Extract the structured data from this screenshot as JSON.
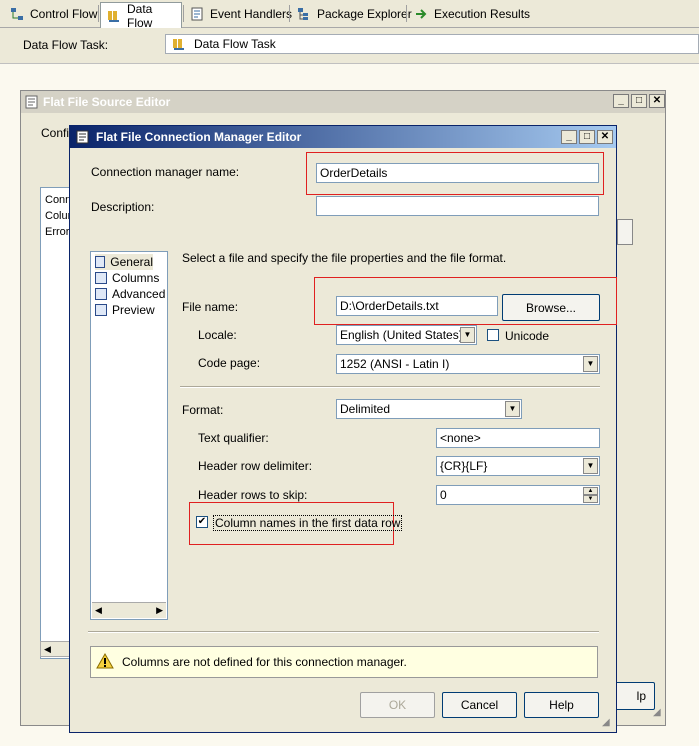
{
  "tabs": [
    {
      "label": "Control Flow",
      "icon": "control-flow-icon"
    },
    {
      "label": "Data Flow",
      "icon": "data-flow-icon"
    },
    {
      "label": "Event Handlers",
      "icon": "event-handlers-icon"
    },
    {
      "label": "Package Explorer",
      "icon": "package-explorer-icon"
    },
    {
      "label": "Execution Results",
      "icon": "execution-results-icon"
    }
  ],
  "task": {
    "label": "Data Flow Task:",
    "value": "Data Flow Task"
  },
  "back_dialog": {
    "title": "Flat File Source Editor",
    "conf_label": "Confi",
    "list_items": [
      "Conn",
      "Colur",
      "Error"
    ],
    "help_partial": "lp"
  },
  "dialog": {
    "title": "Flat File Connection Manager Editor",
    "conn_name_label": "Connection manager name:",
    "conn_name_value": "OrderDetails",
    "description_label": "Description:",
    "description_value": "",
    "nav": [
      {
        "label": "General",
        "icon": "general-icon"
      },
      {
        "label": "Columns",
        "icon": "columns-icon"
      },
      {
        "label": "Advanced",
        "icon": "advanced-icon"
      },
      {
        "label": "Preview",
        "icon": "preview-icon"
      }
    ],
    "intro": "Select a file and specify the file properties and the file format.",
    "file_name_label": "File name:",
    "file_name_value": "D:\\OrderDetails.txt",
    "browse_label": "Browse...",
    "locale_label": "Locale:",
    "locale_value": "English (United States)",
    "unicode_label": "Unicode",
    "unicode_checked": false,
    "code_page_label": "Code page:",
    "code_page_value": "1252  (ANSI - Latin I)",
    "format_label": "Format:",
    "format_value": "Delimited",
    "text_qualifier_label": "Text qualifier:",
    "text_qualifier_value": "<none>",
    "header_row_delim_label": "Header row delimiter:",
    "header_row_delim_value": "{CR}{LF}",
    "header_rows_skip_label": "Header rows to skip:",
    "header_rows_skip_value": "0",
    "column_names_label": "Column names in the first data row",
    "column_names_checked": true,
    "warning": "Columns are not defined for this connection manager.",
    "ok_label": "OK",
    "cancel_label": "Cancel",
    "help_label": "Help"
  }
}
